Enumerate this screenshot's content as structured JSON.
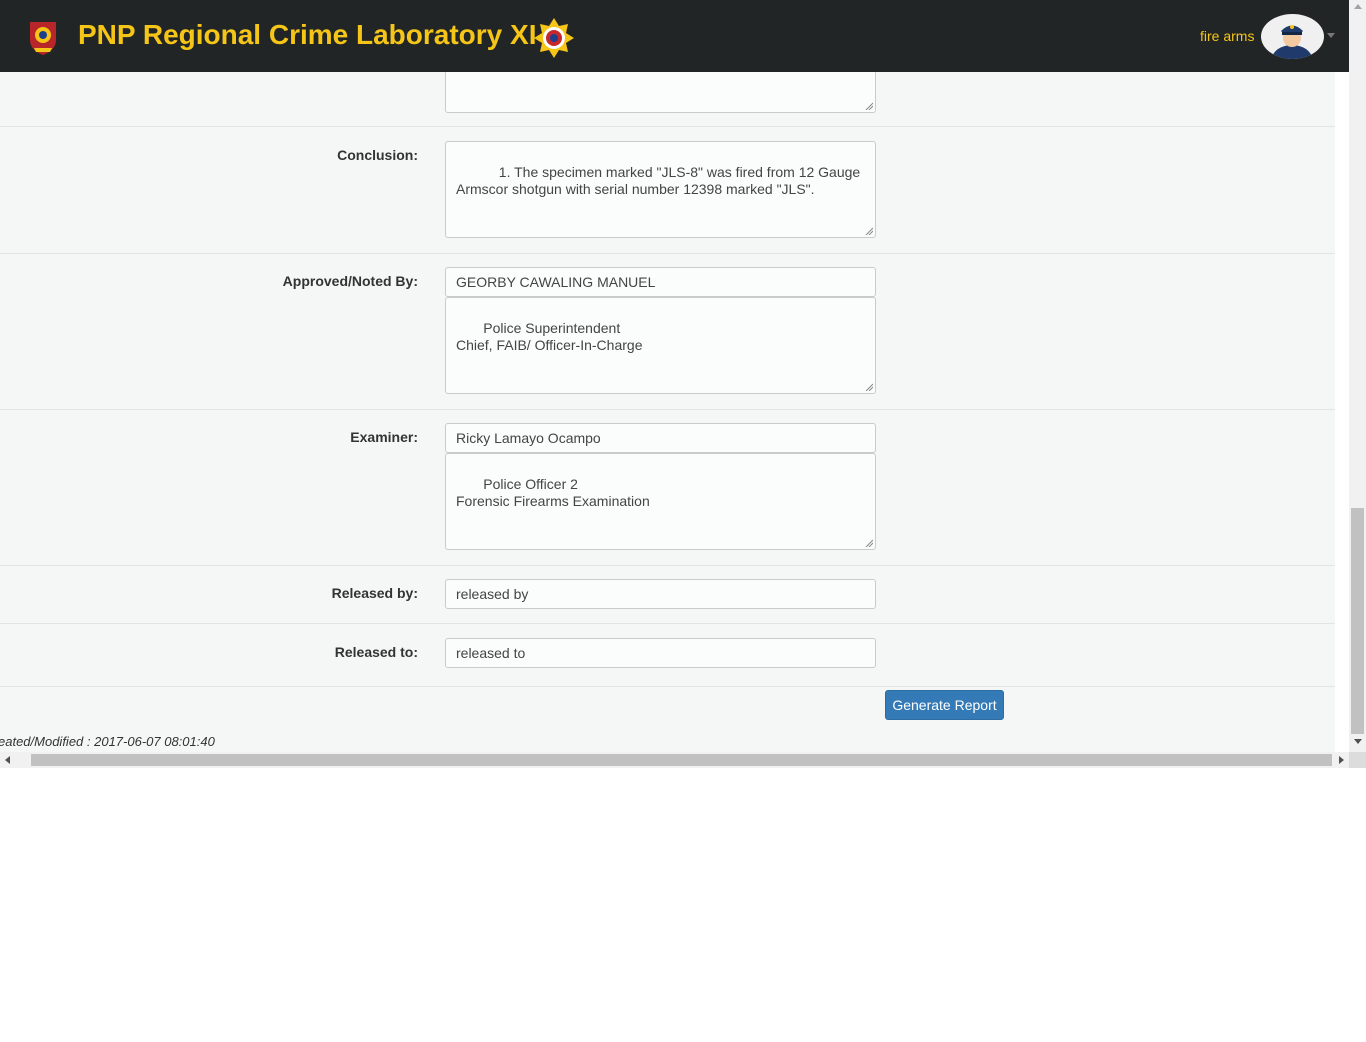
{
  "app": {
    "title": "PNP Regional Crime Laboratory XI",
    "user_name": "fire arms",
    "brand_color": "#f5c518",
    "navbar_color": "#222526",
    "icons": {
      "left_logo": "pnp-seal-icon",
      "right_logo": "crime-lab-badge-icon",
      "avatar": "police-officer-avatar",
      "caret": "caret-down-icon"
    }
  },
  "form": {
    "conclusion": {
      "label": "Conclusion:",
      "value": "     1. The specimen marked \"JLS-8\" was fired from 12 Gauge Armscor shotgun with serial number 12398 marked \"JLS\"."
    },
    "approved": {
      "label": "Approved/Noted By:",
      "name": "GEORBY CAWALING MANUEL",
      "position": " Police Superintendent\nChief, FAIB/ Officer-In-Charge"
    },
    "examiner": {
      "label": "Examiner:",
      "name": "Ricky Lamayo Ocampo",
      "position": " Police Officer 2\nForensic Firearms Examination"
    },
    "released_by": {
      "label": "Released by:",
      "placeholder": "released by"
    },
    "released_to": {
      "label": "Released to:",
      "placeholder": "released to"
    },
    "generate_button": "Generate Report",
    "modified_text": "eated/Modified : 2017-06-07 08:01:40",
    "accent_color": "#337ab7"
  }
}
